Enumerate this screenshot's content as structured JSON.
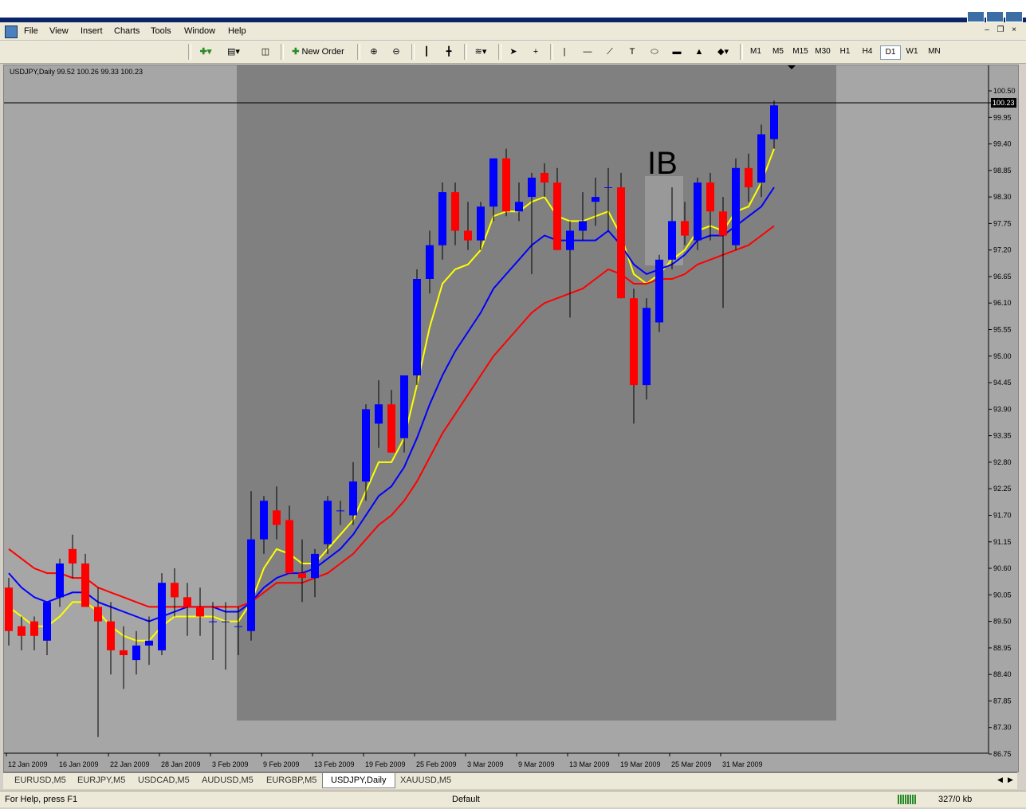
{
  "menu": {
    "items": [
      "File",
      "View",
      "Insert",
      "Charts",
      "Tools",
      "Window",
      "Help"
    ]
  },
  "toolbar": {
    "new_order_label": "New Order",
    "timeframes": [
      "M1",
      "M5",
      "M15",
      "M30",
      "H1",
      "H4",
      "D1",
      "W1",
      "MN"
    ],
    "active_timeframe": "D1"
  },
  "chart": {
    "info_label": "USDJPY,Daily  99.52 100.26 99.33 100.23",
    "current_price_label": "100.23",
    "annotation": "IB",
    "price_ticks": [
      "100.50",
      "99.95",
      "99.40",
      "98.85",
      "98.30",
      "97.75",
      "97.20",
      "96.65",
      "96.10",
      "95.55",
      "95.00",
      "94.45",
      "93.90",
      "93.35",
      "92.80",
      "92.25",
      "91.70",
      "91.15",
      "90.60",
      "90.05",
      "89.50",
      "88.95",
      "88.40",
      "87.85",
      "87.30",
      "86.75"
    ],
    "date_ticks": [
      "12 Jan 2009",
      "16 Jan 2009",
      "22 Jan 2009",
      "28 Jan 2009",
      "3 Feb 2009",
      "9 Feb 2009",
      "13 Feb 2009",
      "19 Feb 2009",
      "25 Feb 2009",
      "3 Mar 2009",
      "9 Mar 2009",
      "13 Mar 2009",
      "19 Mar 2009",
      "25 Mar 2009",
      "31 Mar 2009"
    ],
    "colors": {
      "bull": "#0000ff",
      "bear": "#ff0000",
      "ma_fast": "#ffff00",
      "ma_mid": "#0000ff",
      "ma_slow": "#ff0000",
      "background": "#a6a6a6",
      "highlight": "#808080"
    }
  },
  "chart_data": {
    "type": "candlestick",
    "symbol": "USDJPY",
    "timeframe": "Daily",
    "ylim": [
      86.75,
      100.5
    ],
    "candles": [
      {
        "o": 90.2,
        "h": 90.4,
        "l": 89.0,
        "c": 89.3
      },
      {
        "o": 89.4,
        "h": 89.6,
        "l": 88.9,
        "c": 89.2
      },
      {
        "o": 89.5,
        "h": 89.6,
        "l": 88.9,
        "c": 89.2
      },
      {
        "o": 89.1,
        "h": 89.9,
        "l": 88.8,
        "c": 89.9
      },
      {
        "o": 90.0,
        "h": 90.8,
        "l": 89.8,
        "c": 90.7
      },
      {
        "o": 91.0,
        "h": 91.3,
        "l": 90.4,
        "c": 90.7
      },
      {
        "o": 90.7,
        "h": 90.9,
        "l": 89.8,
        "c": 89.8
      },
      {
        "o": 89.8,
        "h": 90.2,
        "l": 87.1,
        "c": 89.5
      },
      {
        "o": 89.5,
        "h": 89.9,
        "l": 88.4,
        "c": 88.9
      },
      {
        "o": 88.9,
        "h": 89.4,
        "l": 88.1,
        "c": 88.8
      },
      {
        "o": 88.7,
        "h": 89.3,
        "l": 88.4,
        "c": 89.0
      },
      {
        "o": 89.0,
        "h": 89.6,
        "l": 88.6,
        "c": 89.1
      },
      {
        "o": 88.9,
        "h": 90.5,
        "l": 88.8,
        "c": 90.3
      },
      {
        "o": 90.3,
        "h": 90.6,
        "l": 89.6,
        "c": 90.0
      },
      {
        "o": 90.0,
        "h": 90.3,
        "l": 89.2,
        "c": 89.8
      },
      {
        "o": 89.8,
        "h": 90.2,
        "l": 89.2,
        "c": 89.6
      },
      {
        "o": 89.5,
        "h": 89.9,
        "l": 88.7,
        "c": 89.5
      },
      {
        "o": 89.5,
        "h": 89.9,
        "l": 88.5,
        "c": 89.5
      },
      {
        "o": 89.4,
        "h": 89.8,
        "l": 88.8,
        "c": 89.4
      },
      {
        "o": 89.3,
        "h": 92.2,
        "l": 89.1,
        "c": 91.2
      },
      {
        "o": 91.2,
        "h": 92.1,
        "l": 90.9,
        "c": 92.0
      },
      {
        "o": 91.8,
        "h": 92.3,
        "l": 91.2,
        "c": 91.5
      },
      {
        "o": 91.6,
        "h": 91.9,
        "l": 90.5,
        "c": 90.5
      },
      {
        "o": 90.5,
        "h": 91.2,
        "l": 89.9,
        "c": 90.4
      },
      {
        "o": 90.4,
        "h": 91.0,
        "l": 90.0,
        "c": 90.9
      },
      {
        "o": 91.1,
        "h": 92.1,
        "l": 90.9,
        "c": 92.0
      },
      {
        "o": 91.8,
        "h": 92.0,
        "l": 91.5,
        "c": 91.8
      },
      {
        "o": 91.7,
        "h": 92.8,
        "l": 91.5,
        "c": 92.4
      },
      {
        "o": 92.4,
        "h": 94.0,
        "l": 92.0,
        "c": 93.9
      },
      {
        "o": 93.6,
        "h": 94.5,
        "l": 93.1,
        "c": 94.0
      },
      {
        "o": 94.0,
        "h": 94.3,
        "l": 93.3,
        "c": 93.0
      },
      {
        "o": 93.3,
        "h": 94.6,
        "l": 93.0,
        "c": 94.6
      },
      {
        "o": 94.6,
        "h": 96.8,
        "l": 94.4,
        "c": 96.6
      },
      {
        "o": 96.6,
        "h": 97.6,
        "l": 96.3,
        "c": 97.3
      },
      {
        "o": 97.3,
        "h": 98.6,
        "l": 97.0,
        "c": 98.4
      },
      {
        "o": 98.4,
        "h": 98.6,
        "l": 97.3,
        "c": 97.6
      },
      {
        "o": 97.6,
        "h": 98.2,
        "l": 97.2,
        "c": 97.4
      },
      {
        "o": 97.4,
        "h": 98.2,
        "l": 97.2,
        "c": 98.1
      },
      {
        "o": 98.1,
        "h": 99.1,
        "l": 97.8,
        "c": 99.1
      },
      {
        "o": 99.1,
        "h": 99.3,
        "l": 97.9,
        "c": 98.0
      },
      {
        "o": 98.0,
        "h": 98.6,
        "l": 97.8,
        "c": 98.2
      },
      {
        "o": 98.3,
        "h": 98.8,
        "l": 96.7,
        "c": 98.7
      },
      {
        "o": 98.8,
        "h": 99.0,
        "l": 98.3,
        "c": 98.6
      },
      {
        "o": 98.6,
        "h": 98.9,
        "l": 97.2,
        "c": 97.2
      },
      {
        "o": 97.2,
        "h": 97.8,
        "l": 95.8,
        "c": 97.6
      },
      {
        "o": 97.6,
        "h": 98.4,
        "l": 97.4,
        "c": 97.8
      },
      {
        "o": 98.2,
        "h": 98.7,
        "l": 97.7,
        "c": 98.3
      },
      {
        "o": 98.5,
        "h": 98.9,
        "l": 97.6,
        "c": 98.5
      },
      {
        "o": 98.5,
        "h": 98.8,
        "l": 96.2,
        "c": 96.2
      },
      {
        "o": 96.2,
        "h": 96.4,
        "l": 93.6,
        "c": 94.4
      },
      {
        "o": 94.4,
        "h": 96.2,
        "l": 94.1,
        "c": 96.0
      },
      {
        "o": 95.7,
        "h": 97.1,
        "l": 95.5,
        "c": 97.0
      },
      {
        "o": 97.0,
        "h": 98.5,
        "l": 96.8,
        "c": 97.8
      },
      {
        "o": 97.8,
        "h": 98.2,
        "l": 97.3,
        "c": 97.5
      },
      {
        "o": 97.4,
        "h": 98.7,
        "l": 97.2,
        "c": 98.6
      },
      {
        "o": 98.6,
        "h": 98.8,
        "l": 97.4,
        "c": 98.0
      },
      {
        "o": 98.0,
        "h": 98.3,
        "l": 96.0,
        "c": 97.5
      },
      {
        "o": 97.3,
        "h": 99.1,
        "l": 97.2,
        "c": 98.9
      },
      {
        "o": 98.9,
        "h": 99.2,
        "l": 98.2,
        "c": 98.5
      },
      {
        "o": 98.6,
        "h": 99.8,
        "l": 98.3,
        "c": 99.6
      },
      {
        "o": 99.5,
        "h": 100.3,
        "l": 99.3,
        "c": 100.2
      }
    ],
    "moving_averages": [
      {
        "color": "#ffff00",
        "values": [
          89.8,
          89.6,
          89.4,
          89.4,
          89.6,
          89.9,
          89.9,
          89.7,
          89.4,
          89.2,
          89.1,
          89.1,
          89.4,
          89.6,
          89.6,
          89.6,
          89.6,
          89.5,
          89.5,
          89.9,
          90.6,
          91.0,
          90.9,
          90.7,
          90.7,
          91.0,
          91.3,
          91.6,
          92.2,
          92.8,
          92.8,
          93.3,
          94.4,
          95.6,
          96.5,
          96.8,
          96.9,
          97.2,
          97.9,
          98.0,
          98.0,
          98.2,
          98.3,
          97.9,
          97.8,
          97.8,
          97.9,
          98.0,
          97.5,
          96.7,
          96.5,
          96.7,
          97.0,
          97.2,
          97.6,
          97.7,
          97.6,
          98.0,
          98.1,
          98.6,
          99.3
        ]
      },
      {
        "color": "#0000ff",
        "values": [
          90.5,
          90.2,
          90.0,
          89.9,
          90.0,
          90.1,
          90.1,
          89.9,
          89.8,
          89.7,
          89.6,
          89.5,
          89.6,
          89.7,
          89.8,
          89.8,
          89.8,
          89.7,
          89.7,
          89.9,
          90.2,
          90.4,
          90.5,
          90.5,
          90.6,
          90.8,
          91.0,
          91.3,
          91.7,
          92.1,
          92.3,
          92.7,
          93.3,
          94.0,
          94.6,
          95.1,
          95.5,
          95.9,
          96.4,
          96.7,
          97.0,
          97.3,
          97.5,
          97.4,
          97.4,
          97.4,
          97.4,
          97.6,
          97.3,
          96.9,
          96.7,
          96.8,
          96.9,
          97.1,
          97.4,
          97.5,
          97.5,
          97.7,
          97.9,
          98.1,
          98.5
        ]
      },
      {
        "color": "#ff0000",
        "values": [
          91.0,
          90.8,
          90.6,
          90.5,
          90.5,
          90.4,
          90.4,
          90.2,
          90.1,
          90.0,
          89.9,
          89.8,
          89.8,
          89.8,
          89.8,
          89.8,
          89.8,
          89.8,
          89.8,
          89.9,
          90.1,
          90.3,
          90.3,
          90.3,
          90.4,
          90.5,
          90.7,
          90.9,
          91.2,
          91.5,
          91.7,
          92.0,
          92.4,
          92.9,
          93.4,
          93.8,
          94.2,
          94.6,
          95.0,
          95.3,
          95.6,
          95.9,
          96.1,
          96.2,
          96.3,
          96.4,
          96.6,
          96.8,
          96.7,
          96.5,
          96.5,
          96.6,
          96.6,
          96.7,
          96.9,
          97.0,
          97.1,
          97.2,
          97.3,
          97.5,
          97.7
        ]
      }
    ],
    "x_start_date": "12 Jan 2009",
    "x_end_date": "2 Apr 2009"
  },
  "tabs": {
    "items": [
      "EURUSD,M5",
      "EURJPY,M5",
      "USDCAD,M5",
      "AUDUSD,M5",
      "EURGBP,M5",
      "USDJPY,Daily",
      "XAUUSD,M5"
    ],
    "active": "USDJPY,Daily"
  },
  "status": {
    "help": "For Help, press F1",
    "profile": "Default",
    "traffic": "327/0 kb"
  }
}
